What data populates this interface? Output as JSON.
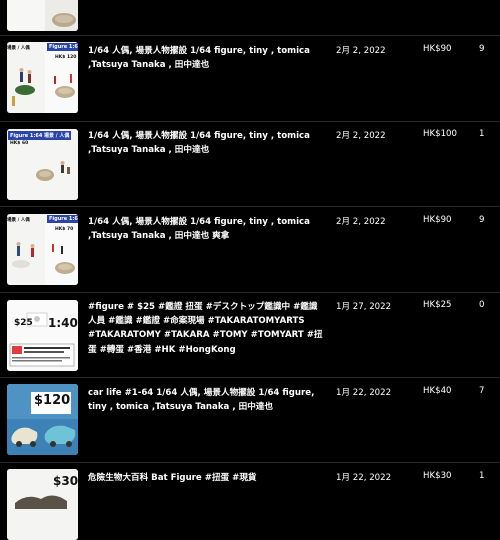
{
  "items": [
    {
      "thumb": {
        "icon": "figure-miniature-thumbnail"
      },
      "title": "",
      "date": "",
      "price": "",
      "qty": ""
    },
    {
      "thumb": {
        "icon": "figure-miniature-thumbnail",
        "tag_text": "Figure 1:64",
        "tag_left": "場景 / 人偶",
        "price_label": "HK$ 120"
      },
      "title": "1/64 人偶, 場景人物擺設 1/64 figure, tiny , tomica ,Tatsuya Tanaka , 田中達也",
      "date": "2月 2, 2022",
      "price": "HK$90",
      "qty": "9"
    },
    {
      "thumb": {
        "icon": "figure-miniature-thumbnail",
        "tag_text": "Figure 1:64 場景 / 人偶",
        "price_label": "HK$ 60"
      },
      "title": "1/64 人偶, 場景人物擺設 1/64 figure, tiny , tomica ,Tatsuya Tanaka , 田中達也",
      "date": "2月 2, 2022",
      "price": "HK$100",
      "qty": "1"
    },
    {
      "thumb": {
        "icon": "figure-miniature-thumbnail",
        "tag_text": "Figure 1:64",
        "tag_left": "場景 / 人偶",
        "price_label": "HK$ 70"
      },
      "title": "1/64 人偶, 場景人物擺設 1/64 figure, tiny , tomica ,Tatsuya Tanaka , 田中達也 爽拿",
      "date": "2月 2, 2022",
      "price": "HK$90",
      "qty": "9"
    },
    {
      "thumb": {
        "icon": "gashapon-card-thumbnail",
        "price_a": "$25",
        "price_b": "1:40"
      },
      "title": "#figure # $25 #鑑證 扭蛋 #デスクトップ鑑識中 #鑑識人員 #鑑識 #鑑證 #命案現場 #TAKARATOMYARTS #TAKARATOMY #TAKARA #TOMY #TOMYART #扭蛋 #轉蛋 #香港 #HK #HongKong",
      "date": "1月 27, 2022",
      "price": "HK$25",
      "qty": "0"
    },
    {
      "thumb": {
        "icon": "car-figure-thumbnail",
        "price_a": "$120"
      },
      "title": "car life #1-64 1/64 人偶, 場景人物擺設 1/64 figure, tiny , tomica ,Tatsuya Tanaka , 田中達也",
      "date": "1月 22, 2022",
      "price": "HK$40",
      "qty": "7"
    },
    {
      "thumb": {
        "icon": "bat-figure-thumbnail",
        "price_a": "$30"
      },
      "title": "危險生物大百科 Bat Figure #扭蛋 #現貨",
      "date": "1月 22, 2022",
      "price": "HK$30",
      "qty": "1"
    }
  ]
}
